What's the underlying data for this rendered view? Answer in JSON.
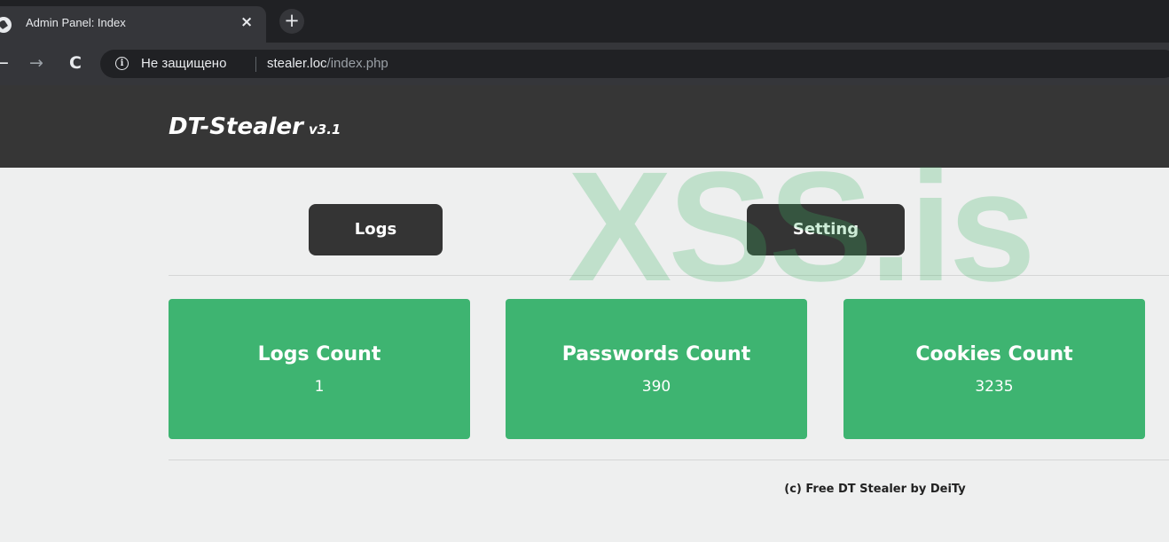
{
  "browser": {
    "tab_title": "Admin Panel: Index",
    "tab_close": "×",
    "new_tab": "+",
    "back": "←",
    "forward": "→",
    "reload": "C",
    "security_label": "Не защищено",
    "url_host": "stealer.loc",
    "url_path": "/index.php"
  },
  "header": {
    "brand": "DT-Stealer",
    "version": "v3.1"
  },
  "nav": {
    "logs_label": "Logs",
    "setting_label": "Setting"
  },
  "stats": [
    {
      "title": "Logs Count",
      "value": "1"
    },
    {
      "title": "Passwords Count",
      "value": "390"
    },
    {
      "title": "Cookies Count",
      "value": "3235"
    }
  ],
  "footer": {
    "text": "(c) Free DT Stealer by DeiTy"
  },
  "watermark": "XSS.is",
  "colors": {
    "header_bg": "#363636",
    "card_bg": "#3eb471",
    "page_bg": "#eeefef"
  }
}
